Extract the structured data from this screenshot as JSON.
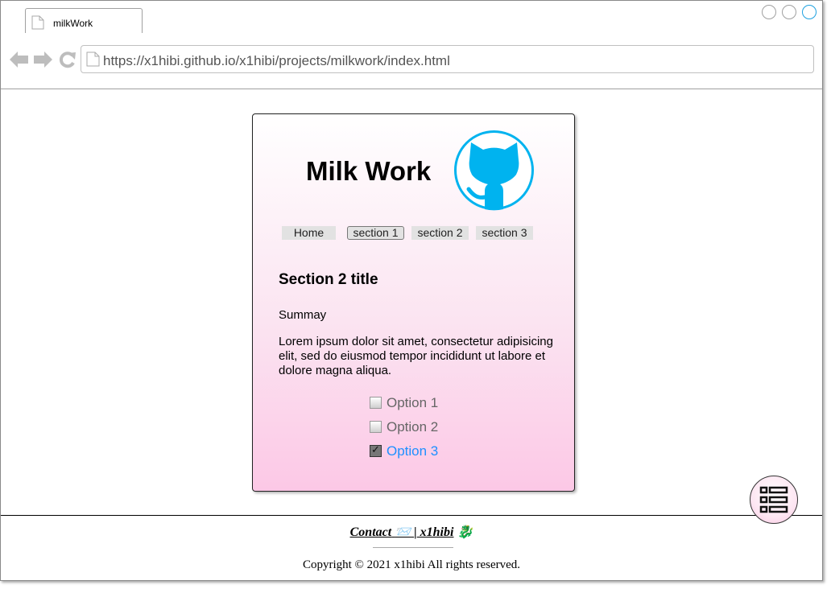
{
  "browser": {
    "tab_title": "milkWork",
    "url": "https://x1hibi.github.io/x1hibi/projects/milkwork/index.html",
    "icons": [
      "page-icon",
      "back-arrow-icon",
      "forward-arrow-icon",
      "reload-icon"
    ],
    "window_controls": [
      "window-control-1",
      "window-control-2",
      "window-control-3"
    ]
  },
  "page": {
    "title": "Milk Work",
    "logo": "github-octocat-logo",
    "nav": [
      {
        "label": "Home",
        "selected": false
      },
      {
        "label": "section 1",
        "selected": true
      },
      {
        "label": "section 2",
        "selected": false
      },
      {
        "label": "section 3",
        "selected": false
      }
    ],
    "section_title": "Section 2 title",
    "summary": "Summay",
    "body": "Lorem ipsum dolor sit amet, consectetur adipisicing elit, sed do eiusmod tempor incididunt ut labore et dolore magna aliqua.",
    "options": [
      {
        "label": "Option 1",
        "checked": false
      },
      {
        "label": "Option 2",
        "checked": false
      },
      {
        "label": "Option 3",
        "checked": true
      }
    ],
    "accent_color": "#00b3ef",
    "selected_option_color": "#1e90ff"
  },
  "footer": {
    "contact_label": "Contact",
    "contact_emoji": "📨",
    "separator": "|",
    "author": "x1hibi",
    "author_emoji": "🐉",
    "copyright": "Copyright © 2021 x1hibi  All rights reserved."
  },
  "fab": {
    "icon": "list-icon"
  }
}
